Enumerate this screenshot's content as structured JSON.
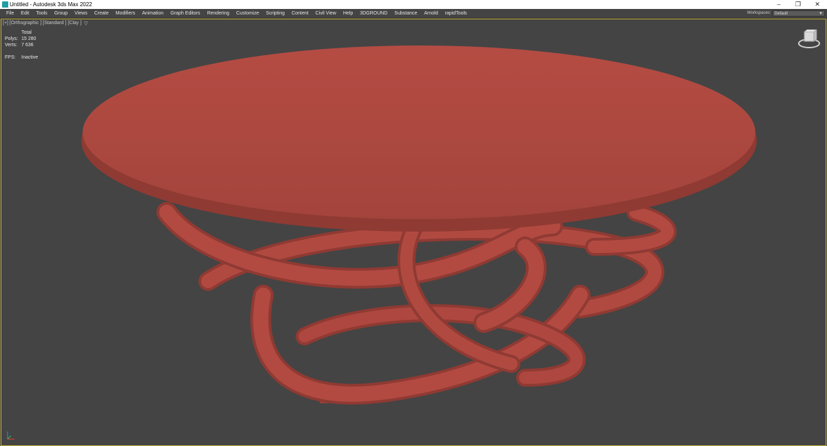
{
  "window": {
    "title": "Untitled - Autodesk 3ds Max 2022",
    "minimize_glyph": "–",
    "restore_glyph": "❐",
    "close_glyph": "✕"
  },
  "menu": {
    "items": [
      "File",
      "Edit",
      "Tools",
      "Group",
      "Views",
      "Create",
      "Modifiers",
      "Animation",
      "Graph Editors",
      "Rendering",
      "Customize",
      "Scripting",
      "Content",
      "Civil View",
      "Help",
      "3DGROUND",
      "Substance",
      "Arnold",
      "rapidTools"
    ],
    "workspace_label": "Workspaces:",
    "workspace_value": "Default"
  },
  "viewport": {
    "label": "[+] [Orthographic ] [Standard ] [Clay ]",
    "filter_glyph": "▽",
    "stats": {
      "header": "Total",
      "polys_label": "Polys:",
      "polys_value": "15 280",
      "verts_label": "Verts:",
      "verts_value": "7 636",
      "fps_label": "FPS:",
      "fps_value": "Inactive"
    },
    "border_color": "#c9b23a",
    "background_color": "#444444",
    "model_color": "#b24a42"
  },
  "icons": {
    "app": "3dsmax-app-icon",
    "viewcube": "viewcube-icon",
    "axis": "axis-tripod-icon"
  }
}
